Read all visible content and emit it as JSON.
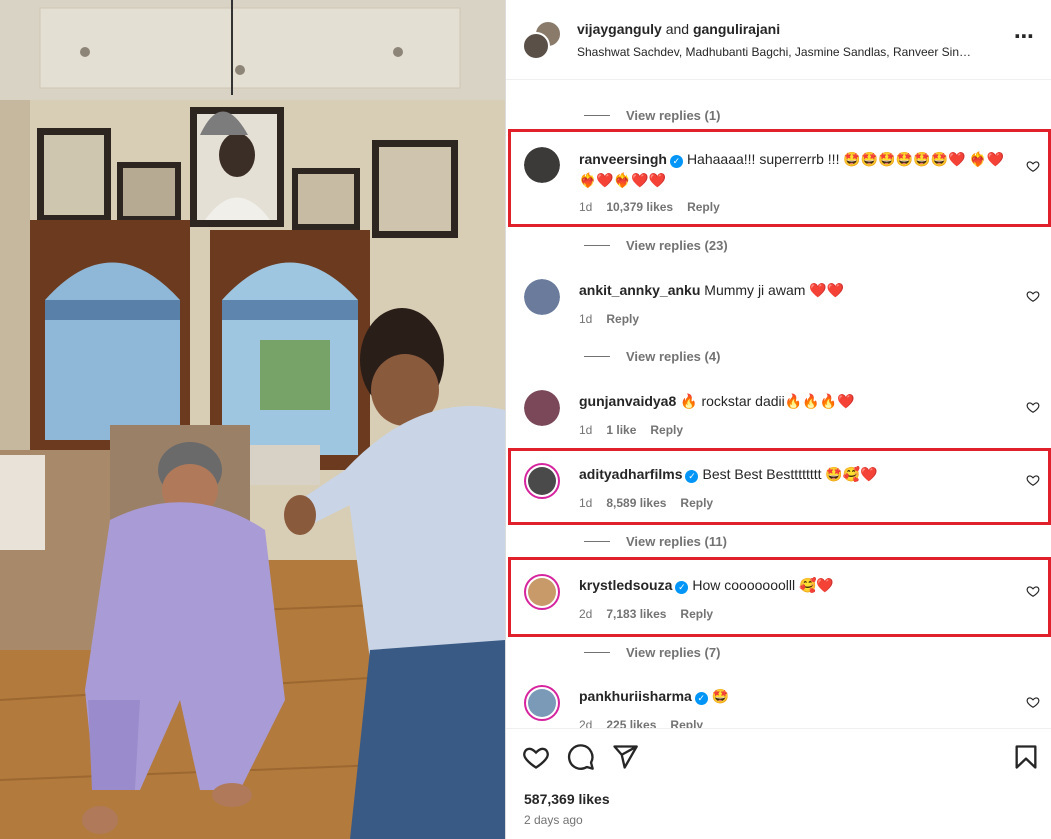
{
  "header": {
    "user1": "vijayganguly",
    "joiner": "and",
    "user2": "gangulirajani",
    "subtitle": "Shashwat Sachdev, Madhubanti Bagchi, Jasmine Sandlas, Ranveer Sin…"
  },
  "comments": [
    {
      "type": "replies",
      "label": "View replies (1)"
    },
    {
      "type": "comment",
      "user": "ranveersingh",
      "verified": true,
      "text": "Hahaaaa!!! superrerrb !!! 🤩🤩🤩🤩🤩🤩❤️ ❤️‍🔥❤️❤️‍🔥❤️❤️‍🔥❤️❤️",
      "time": "1d",
      "likes": "10,379 likes",
      "reply": "Reply",
      "highlighted": true
    },
    {
      "type": "replies",
      "label": "View replies (23)"
    },
    {
      "type": "comment",
      "user": "ankit_annky_anku",
      "verified": false,
      "text": "Mummy ji awam ❤️❤️",
      "time": "1d",
      "likes": "",
      "reply": "Reply",
      "highlighted": false
    },
    {
      "type": "replies",
      "label": "View replies (4)"
    },
    {
      "type": "comment",
      "user": "gunjanvaidya8",
      "verified": false,
      "text": "🔥 rockstar dadii🔥🔥🔥❤️",
      "time": "1d",
      "likes": "1 like",
      "reply": "Reply",
      "highlighted": false
    },
    {
      "type": "comment",
      "user": "adityadharfilms",
      "verified": true,
      "text": "Best Best Bestttttttt 🤩🥰❤️",
      "time": "1d",
      "likes": "8,589 likes",
      "reply": "Reply",
      "highlighted": true
    },
    {
      "type": "replies",
      "label": "View replies (11)"
    },
    {
      "type": "comment",
      "user": "krystledsouza",
      "verified": true,
      "text": "How cooooooolll 🥰❤️",
      "time": "2d",
      "likes": "7,183 likes",
      "reply": "Reply",
      "highlighted": true
    },
    {
      "type": "replies",
      "label": "View replies (7)"
    },
    {
      "type": "comment",
      "user": "pankhuriisharma",
      "verified": true,
      "text": "🤩",
      "time": "2d",
      "likes": "225 likes",
      "reply": "Reply",
      "highlighted": false
    }
  ],
  "footer": {
    "likes_total": "587,369 likes",
    "time_ago": "2 days ago"
  },
  "icons": [
    "like-icon",
    "comment-icon",
    "share-icon",
    "save-icon",
    "more-icon",
    "verified-icon",
    "heart-icon"
  ],
  "colors": {
    "highlight": "#e0202a",
    "verified": "#0095f6",
    "muted": "#737373"
  }
}
